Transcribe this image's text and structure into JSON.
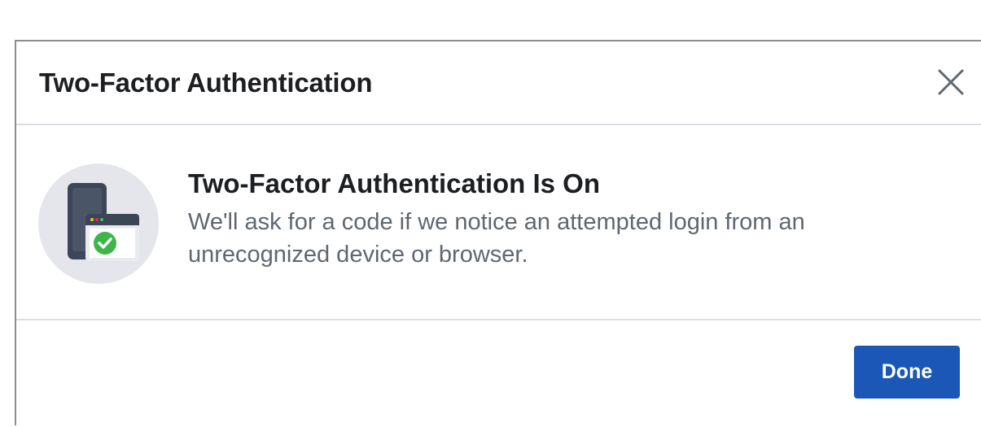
{
  "dialog": {
    "title": "Two-Factor Authentication",
    "close_icon": "close-icon"
  },
  "status": {
    "illustration_icon": "phone-browser-check-icon",
    "title": "Two-Factor Authentication Is On",
    "description": "We'll ask for a code if we notice an attempted login from an unrecognized device or browser."
  },
  "footer": {
    "done_label": "Done"
  },
  "colors": {
    "accent": "#1a57b7",
    "success": "#3eb54a",
    "title_text": "#1c1e21",
    "secondary_text": "#606770"
  }
}
